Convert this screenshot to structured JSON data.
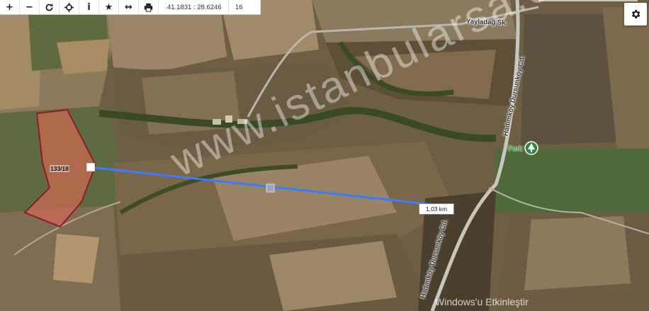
{
  "toolbar": {
    "buttons": [
      {
        "name": "zoom-in-icon",
        "glyph": "+"
      },
      {
        "name": "zoom-out-icon",
        "glyph": "−"
      },
      {
        "name": "refresh-icon",
        "glyph": "refresh"
      },
      {
        "name": "locate-icon",
        "glyph": "crosshair"
      },
      {
        "name": "info-icon",
        "glyph": "i"
      },
      {
        "name": "star-icon",
        "glyph": "★"
      },
      {
        "name": "measure-icon",
        "glyph": "↔"
      },
      {
        "name": "print-icon",
        "glyph": "printer"
      }
    ],
    "coordinates": "41.1831 : 28.6246",
    "zoom": "16"
  },
  "map": {
    "road_labels": [
      "Yayladağ Sk.",
      "Hadımköy Dursunköy Cd.",
      "Hadımköy Dursunköy Cd."
    ],
    "parcel_label": "133/18",
    "distance_label": "1,03 km",
    "park_label": "Park",
    "watermark": "www.istanbularsa.com.tr",
    "os_notice": "Windows'u Etkinleştir"
  },
  "colors": {
    "parcel_stroke": "#8b1d2c",
    "parcel_fill": "#e06a55",
    "measure_line": "#3a7bff",
    "park_green": "#2b8a3e"
  },
  "icons": {
    "settings": "gear-icon"
  }
}
